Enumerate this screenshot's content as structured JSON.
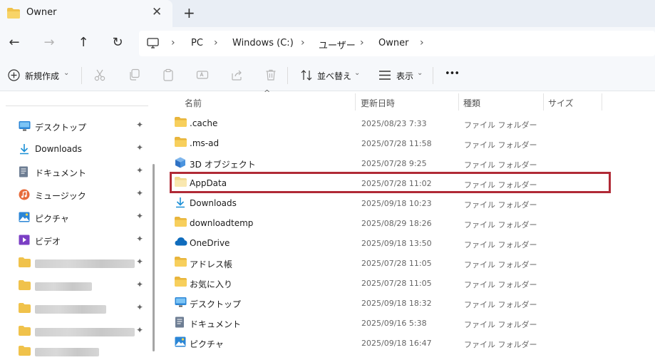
{
  "tab": {
    "title": "Owner",
    "close": "✕",
    "new_tab": "+"
  },
  "nav": {
    "back": "←",
    "forward": "→",
    "up": "↑",
    "refresh": "↻",
    "breadcrumbs": [
      "PC",
      "Windows (C:)",
      "ユーザー",
      "Owner"
    ],
    "separator": "›"
  },
  "toolbar": {
    "new_label": "新規作成",
    "sort_label": "並べ替え",
    "view_label": "表示",
    "more": "•••"
  },
  "sidebar": {
    "items": [
      {
        "label": "デスクトップ",
        "icon": "desktop-icon"
      },
      {
        "label": "Downloads",
        "icon": "download-icon"
      },
      {
        "label": "ドキュメント",
        "icon": "document-icon"
      },
      {
        "label": "ミュージック",
        "icon": "music-icon"
      },
      {
        "label": "ピクチャ",
        "icon": "pictures-icon"
      },
      {
        "label": "ビデオ",
        "icon": "video-icon"
      }
    ],
    "pin": "📌"
  },
  "columns": {
    "name": "名前",
    "date": "更新日時",
    "type": "種類",
    "size": "サイズ",
    "sort_caret": "^"
  },
  "files": [
    {
      "name": ".cache",
      "date": "2025/08/23 7:33",
      "type": "ファイル フォルダー",
      "icon": "folder-icon"
    },
    {
      "name": ".ms-ad",
      "date": "2025/07/28 11:58",
      "type": "ファイル フォルダー",
      "icon": "folder-icon"
    },
    {
      "name": "3D オブジェクト",
      "date": "2025/07/28 9:25",
      "type": "ファイル フォルダー",
      "icon": "3d-objects-icon"
    },
    {
      "name": "AppData",
      "date": "2025/07/28 11:02",
      "type": "ファイル フォルダー",
      "icon": "folder-icon"
    },
    {
      "name": "Downloads",
      "date": "2025/09/18 10:23",
      "type": "ファイル フォルダー",
      "icon": "download-icon"
    },
    {
      "name": "downloadtemp",
      "date": "2025/08/29 18:26",
      "type": "ファイル フォルダー",
      "icon": "folder-icon"
    },
    {
      "name": "OneDrive",
      "date": "2025/09/18 13:50",
      "type": "ファイル フォルダー",
      "icon": "cloud-icon"
    },
    {
      "name": "アドレス帳",
      "date": "2025/07/28 11:05",
      "type": "ファイル フォルダー",
      "icon": "folder-icon"
    },
    {
      "name": "お気に入り",
      "date": "2025/07/28 11:05",
      "type": "ファイル フォルダー",
      "icon": "folder-icon"
    },
    {
      "name": "デスクトップ",
      "date": "2025/09/18 18:32",
      "type": "ファイル フォルダー",
      "icon": "desktop-icon"
    },
    {
      "name": "ドキュメント",
      "date": "2025/09/16 5:38",
      "type": "ファイル フォルダー",
      "icon": "document-icon"
    },
    {
      "name": "ピクチャ",
      "date": "2025/09/18 16:47",
      "type": "ファイル フォルダー",
      "icon": "pictures-icon"
    }
  ],
  "colors": {
    "highlight": "#b02a36",
    "folder": "#f0c24b",
    "accent": "#0a7ad1"
  }
}
